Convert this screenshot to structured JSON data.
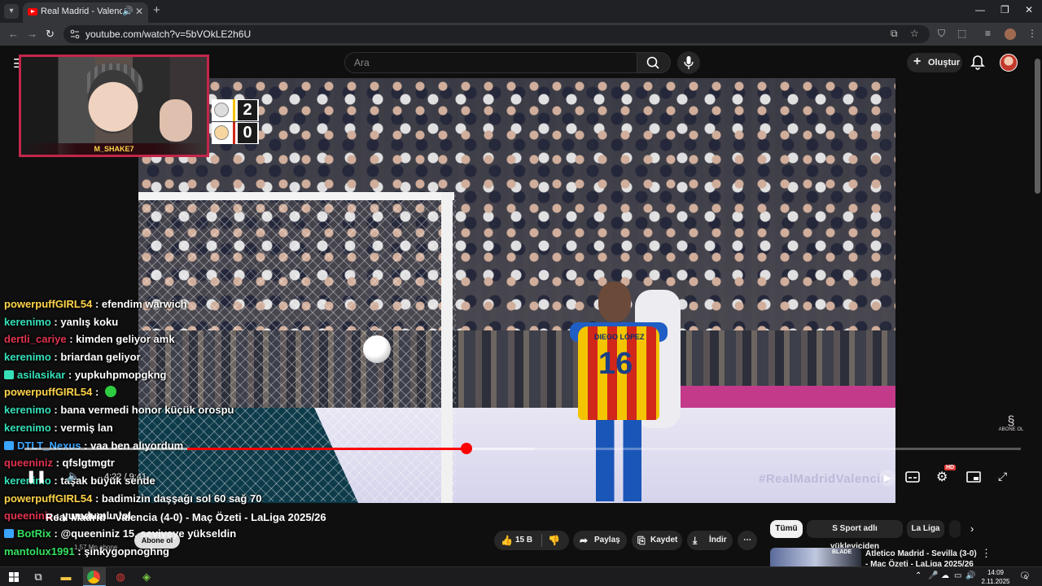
{
  "browser": {
    "tab_title": "Real Madrid - Valencia (4-0)",
    "url": "youtube.com/watch?v=5bVOkLE2h6U",
    "icons": [
      "tab-search-icon",
      "audio-icon",
      "close-icon",
      "plus-icon",
      "minimize-icon",
      "restore-icon",
      "close-window-icon",
      "back-icon",
      "forward-icon",
      "reload-icon",
      "site-info-icon",
      "install-icon",
      "star-icon",
      "shield-icon",
      "extensions-icon",
      "tab-strip-icon",
      "profile-icon",
      "kebab-icon"
    ]
  },
  "youtube": {
    "search_placeholder": "Ara",
    "create_label": "Oluştur",
    "colors": {
      "accent": "#ff0000",
      "background": "#0f0f0f"
    }
  },
  "video": {
    "banner_text": "#RealMadridValencia",
    "player_name_on_shirt": "DIEGO LÓPEZ",
    "player_number": "16",
    "watermark": "ABONE OL",
    "progress_fraction": 0.46,
    "current_time": "4:22",
    "duration": "9:41",
    "time_display": "4:22 / 9:41",
    "hd_badge": "HD"
  },
  "scoreboard": {
    "home_score": "2",
    "away_score": "0",
    "home_color": "#f4c400",
    "away_color": "#d1271b"
  },
  "webcam": {
    "streamer_name": "M_SHAKE7"
  },
  "chat": [
    {
      "user": "powerpuffGIRL54",
      "color": "#ffd54a",
      "msg": "efendim warwich"
    },
    {
      "user": "kerenimo",
      "color": "#35e0b8",
      "msg": "yanlış koku"
    },
    {
      "user": "dertli_cariye",
      "color": "#e0334f",
      "msg": "kimden geliyor amk"
    },
    {
      "user": "kerenimo",
      "color": "#35e0b8",
      "msg": "briardan geliyor"
    },
    {
      "user": "asilasikar",
      "color": "#35e0b8",
      "msg": "yupkuhpmopgkng",
      "badge": "#35e0b8"
    },
    {
      "user": "powerpuffGIRL54",
      "color": "#ffd54a",
      "msg": "",
      "emote": true
    },
    {
      "user": "kerenimo",
      "color": "#35e0b8",
      "msg": "bana vermedi honor küçük orospu"
    },
    {
      "user": "kerenimo",
      "color": "#35e0b8",
      "msg": "vermiş lan"
    },
    {
      "user": "DTLT_Nexus",
      "color": "#3ba5ff",
      "msg": "vaa ben alıyordum",
      "badge": "#3ba5ff"
    },
    {
      "user": "queeniniz",
      "color": "#e0334f",
      "msg": "qfslgtmgtr"
    },
    {
      "user": "kerenimo",
      "color": "#35e0b8",
      "msg": "taşak büyük sende"
    },
    {
      "user": "powerpuffGIRL54",
      "color": "#ffd54a",
      "msg": "badimizin daşşağı sol 60 sağ 70"
    },
    {
      "user": "queeniniz",
      "color": "#e0334f",
      "msg": "yumdumlu lol"
    },
    {
      "user": "BotRix",
      "color": "#35e060",
      "msg": "@queeniniz 15. seviyeye yükseldin",
      "badge": "#3ba5ff"
    },
    {
      "user": "mantolux1991",
      "color": "#35e060",
      "msg": "şinkygopnoghng"
    }
  ],
  "below": {
    "video_title": "Real Madrid - Valencia (4-0) - Maç Özeti - LaLiga 2025/26",
    "subscribers": "1,57 Mn abone",
    "subscribe_label": "Abone ol",
    "likes": "15 B",
    "share": "Paylaş",
    "save": "Kaydet",
    "download": "İndir"
  },
  "chips": [
    "Tümü",
    "S Sport adlı yükleyiciden",
    "La Liga"
  ],
  "recommendation": {
    "title": "Atletico Madrid - Sevilla (3-0) - Maç Özeti - LaLiga 2025/26",
    "thumb_label": "BLADE"
  },
  "taskbar": {
    "time": "14:09",
    "date": "2.11.2025",
    "notif_count": "6"
  }
}
